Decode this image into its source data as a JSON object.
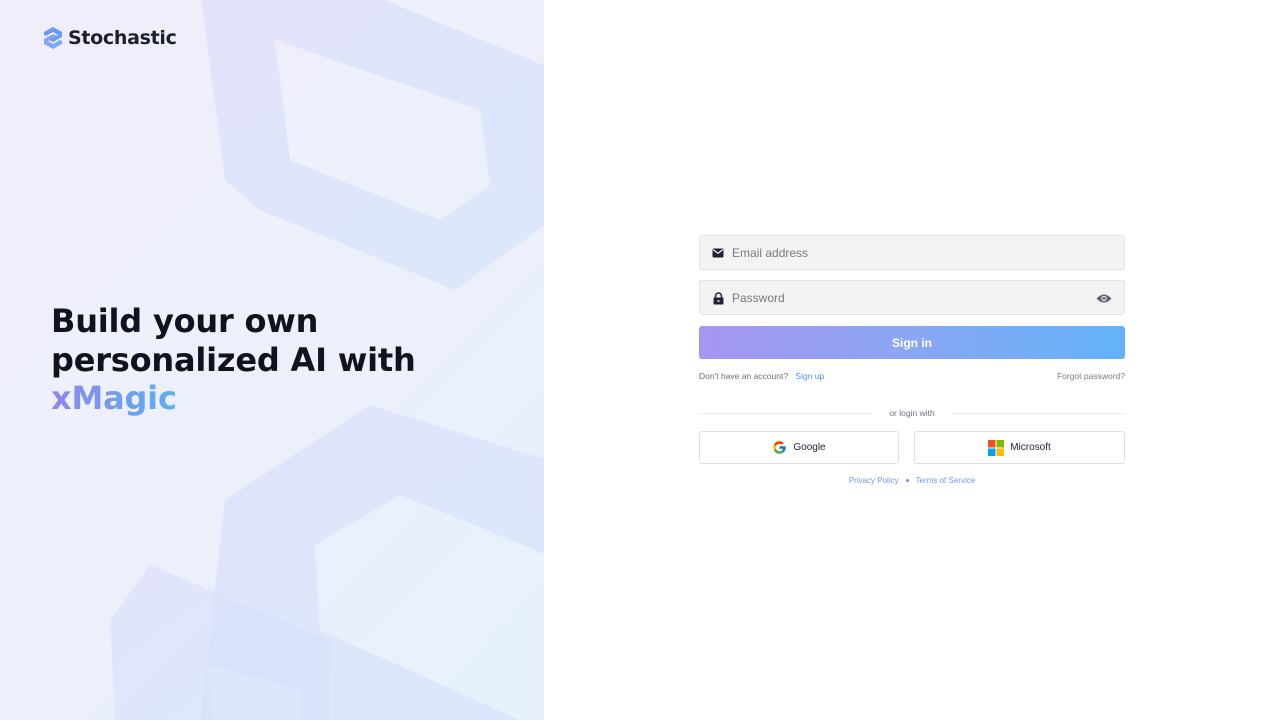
{
  "brand": {
    "name": "Stochastic",
    "logo_icon": "stochastic-logo-icon"
  },
  "hero": {
    "line1": "Build your own",
    "line2": "personalized AI with",
    "accent": "xMagic",
    "accent_colors": [
      "#8f86ee",
      "#5ab0f5"
    ]
  },
  "login_form": {
    "email": {
      "placeholder": "Email address",
      "value": "",
      "icon": "envelope-icon"
    },
    "password": {
      "placeholder": "Password",
      "value": "",
      "icon": "lock-icon",
      "toggle_icon": "eye-icon"
    },
    "sign_in_label": "Sign in",
    "sign_in_gradient": [
      "#a796f1",
      "#62b2f8"
    ],
    "no_account_text": "Don't have an account?",
    "sign_up_label": "Sign up",
    "forgot_password_label": "Forgot password?",
    "divider_text": "or login with",
    "google_label": "Google",
    "microsoft_label": "Microsoft"
  },
  "footer": {
    "privacy_label": "Privacy Policy",
    "terms_label": "Terms of Service"
  }
}
